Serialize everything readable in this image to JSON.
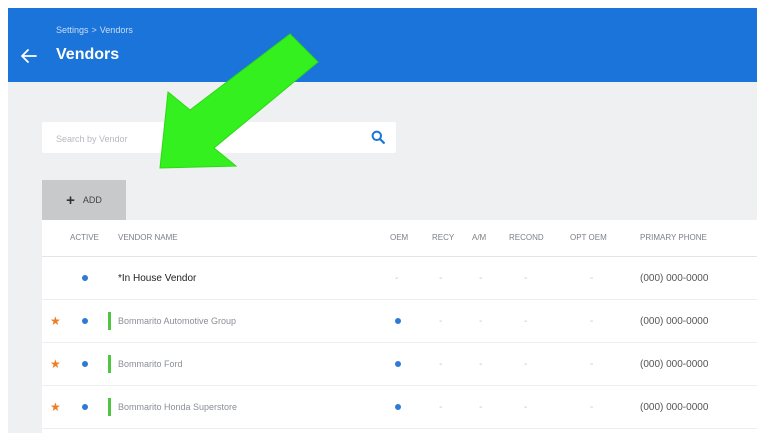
{
  "header": {
    "breadcrumb": [
      "Settings",
      ">",
      "Vendors"
    ],
    "title": "Vendors"
  },
  "search": {
    "placeholder": "Search by Vendor",
    "value": ""
  },
  "toolbar": {
    "add_label": "ADD"
  },
  "table": {
    "columns": [
      "ACTIVE",
      "VENDOR NAME",
      "OEM",
      "RECY",
      "A/M",
      "RECOND",
      "OPT OEM",
      "PRIMARY PHONE"
    ],
    "rows": [
      {
        "star": false,
        "active": true,
        "name": "*In House Vendor",
        "oem": "-",
        "recy": "-",
        "am": "-",
        "recond": "-",
        "opt_oem": "-",
        "phone": "(000) 000-0000"
      },
      {
        "star": true,
        "active": true,
        "name": "Bommarito Automotive Group",
        "oem": "●",
        "recy": "-",
        "am": "-",
        "recond": "-",
        "opt_oem": "-",
        "phone": "(000) 000-0000"
      },
      {
        "star": true,
        "active": true,
        "name": "Bommarito Ford",
        "oem": "●",
        "recy": "-",
        "am": "-",
        "recond": "-",
        "opt_oem": "-",
        "phone": "(000) 000-0000"
      },
      {
        "star": true,
        "active": true,
        "name": "Bommarito Honda Superstore",
        "oem": "●",
        "recy": "-",
        "am": "-",
        "recond": "-",
        "opt_oem": "-",
        "phone": "(000) 000-0000"
      }
    ]
  },
  "colors": {
    "header_bg": "#1b74d9",
    "star": "#ef7d22",
    "active_dot": "#2f7ad8",
    "vendor_bar": "#4fc542",
    "annotation_arrow": "#35f01f"
  }
}
